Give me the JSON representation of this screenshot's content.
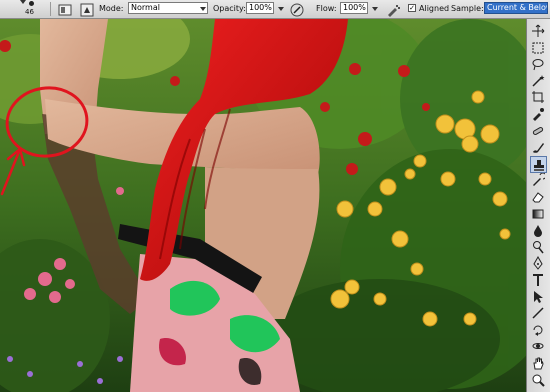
{
  "options_bar": {
    "brush_size": "46",
    "mode_label": "Mode:",
    "mode_value": "Normal",
    "opacity_label": "Opacity:",
    "opacity_value": "100%",
    "flow_label": "Flow:",
    "flow_value": "100%",
    "aligned_label": "Aligned",
    "aligned_checked": true,
    "sample_label": "Sample:",
    "sample_value": "Current & Below"
  },
  "tools": [
    {
      "name": "move-tool",
      "icon": "move-icon"
    },
    {
      "name": "marquee-tool",
      "icon": "marquee-icon"
    },
    {
      "name": "lasso-tool",
      "icon": "lasso-icon"
    },
    {
      "name": "quick-selection-tool",
      "icon": "wand-icon"
    },
    {
      "name": "crop-tool",
      "icon": "crop-icon"
    },
    {
      "name": "eyedropper-tool",
      "icon": "eyedropper-icon"
    },
    {
      "name": "healing-brush-tool",
      "icon": "bandage-icon"
    },
    {
      "name": "brush-tool",
      "icon": "brush-icon"
    },
    {
      "name": "clone-stamp-tool",
      "icon": "stamp-icon",
      "active": true
    },
    {
      "name": "history-brush-tool",
      "icon": "history-brush-icon"
    },
    {
      "name": "eraser-tool",
      "icon": "eraser-icon"
    },
    {
      "name": "gradient-tool",
      "icon": "gradient-icon"
    },
    {
      "name": "blur-tool",
      "icon": "drop-icon"
    },
    {
      "name": "dodge-tool",
      "icon": "dodge-icon"
    },
    {
      "name": "pen-tool",
      "icon": "pen-icon"
    },
    {
      "name": "type-tool",
      "icon": "type-icon"
    },
    {
      "name": "path-selection-tool",
      "icon": "arrow-icon"
    },
    {
      "name": "shape-tool",
      "icon": "line-icon"
    },
    {
      "name": "3d-rotate-tool",
      "icon": "3d-rotate-icon"
    },
    {
      "name": "3d-orbit-tool",
      "icon": "3d-orbit-icon"
    },
    {
      "name": "hand-tool",
      "icon": "hand-icon"
    },
    {
      "name": "zoom-tool",
      "icon": "magnifier-icon"
    }
  ],
  "colors": {
    "hair": "#d10c0c",
    "skin": "#d7a98d",
    "annotation": "#e0141e",
    "foliage": "#2e6b1e",
    "sample_highlight": "#3270c8"
  }
}
